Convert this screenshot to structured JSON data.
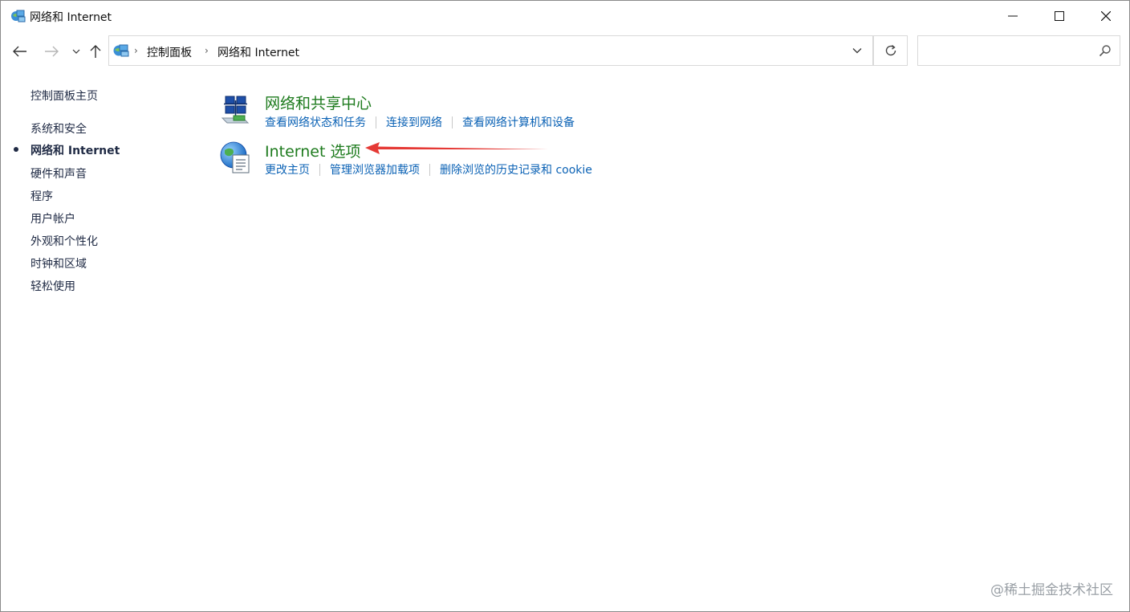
{
  "window": {
    "title": "网络和 Internet",
    "icon": "control-panel-network-icon"
  },
  "address": {
    "crumbs": [
      "控制面板",
      "网络和 Internet"
    ]
  },
  "search": {
    "value": "",
    "placeholder": ""
  },
  "sidebar": {
    "items": [
      {
        "label": "控制面板主页"
      },
      {
        "label": "系统和安全"
      },
      {
        "label": "网络和 Internet",
        "active": true
      },
      {
        "label": "硬件和声音"
      },
      {
        "label": "程序"
      },
      {
        "label": "用户帐户"
      },
      {
        "label": "外观和个性化"
      },
      {
        "label": "时钟和区域"
      },
      {
        "label": "轻松使用"
      }
    ]
  },
  "categories": [
    {
      "title": "网络和共享中心",
      "icon": "network-sharing-center-icon",
      "links": [
        "查看网络状态和任务",
        "连接到网络",
        "查看网络计算机和设备"
      ]
    },
    {
      "title": "Internet 选项",
      "icon": "internet-options-globe-icon",
      "links": [
        "更改主页",
        "管理浏览器加载项",
        "删除浏览的历史记录和 cookie"
      ]
    }
  ],
  "annotation": {
    "arrow_color": "#e53935"
  },
  "watermark": "@稀土掘金技术社区",
  "colors": {
    "category_title": "#1e7b1e",
    "link": "#0b62b5",
    "nav_text": "#1f2a44"
  }
}
